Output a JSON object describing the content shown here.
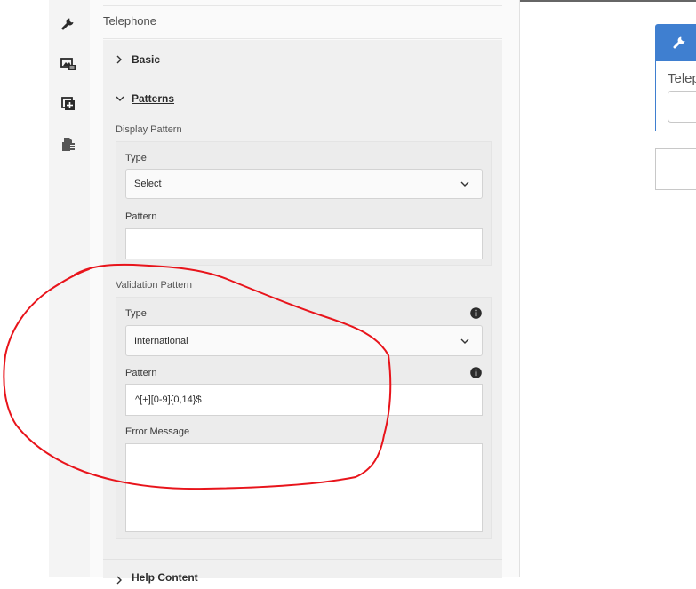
{
  "rail": {
    "icons": [
      "wrench-icon",
      "image-settings-icon",
      "add-component-icon",
      "content-tree-icon"
    ]
  },
  "panel": {
    "title": "Telephone",
    "accordion": {
      "basic_label": "Basic",
      "patterns_label": "Patterns",
      "next_label": "Help Content"
    },
    "display_pattern": {
      "section_label": "Display Pattern",
      "type_label": "Type",
      "type_value": "Select",
      "pattern_label": "Pattern",
      "pattern_value": ""
    },
    "validation_pattern": {
      "section_label": "Validation Pattern",
      "type_label": "Type",
      "type_value": "International",
      "pattern_label": "Pattern",
      "pattern_value": "^[+][0-9]{0,14}$",
      "error_label": "Error Message",
      "error_value": ""
    }
  },
  "canvas": {
    "component_label": "Telep"
  },
  "colors": {
    "accent": "#3f7fd0",
    "annotation": "#e8141b"
  }
}
